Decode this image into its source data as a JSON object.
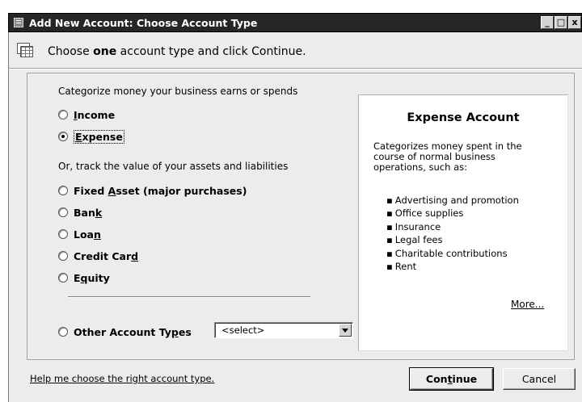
{
  "window": {
    "title": "Add New Account: Choose Account Type",
    "controls": {
      "minimize": "_",
      "maximize": "□",
      "close": "x"
    }
  },
  "header": {
    "text_before": "Choose ",
    "text_bold": "one",
    "text_after": " account type and click Continue."
  },
  "sections": {
    "earn_spend_label": "Categorize money your business earns or spends",
    "assets_label": "Or, track the value of your assets and liabilities"
  },
  "account_types": {
    "income": {
      "pre": "",
      "key": "I",
      "post": "ncome",
      "selected": false
    },
    "expense": {
      "pre": "",
      "key": "E",
      "post": "xpense",
      "selected": true
    },
    "fixed_asset": {
      "pre": "Fixed ",
      "key": "A",
      "post": "sset (major purchases)",
      "selected": false
    },
    "bank": {
      "pre": "Ban",
      "key": "k",
      "post": "",
      "selected": false
    },
    "loan": {
      "pre": "Loa",
      "key": "n",
      "post": "",
      "selected": false
    },
    "credit_card": {
      "pre": "Credit Car",
      "key": "d",
      "post": "",
      "selected": false
    },
    "equity": {
      "pre": "E",
      "key": "q",
      "post": "uity",
      "selected": false
    },
    "other": {
      "pre": "Other Account Ty",
      "key": "p",
      "post": "es",
      "selected": false
    }
  },
  "other_select": {
    "value": "<select>"
  },
  "info_panel": {
    "title": "Expense Account",
    "description": "Categorizes money spent in the course of normal business operations, such as:",
    "items": [
      "Advertising and promotion",
      "Office supplies",
      "Insurance",
      "Legal fees",
      "Charitable contributions",
      "Rent"
    ],
    "more_link": "More..."
  },
  "footer": {
    "help_link": "Help me choose the right account type.",
    "continue": {
      "pre": "Con",
      "key": "t",
      "post": "inue"
    },
    "cancel": "Cancel"
  },
  "colors": {
    "titlebar": "#262626",
    "dialog_bg": "#ececec",
    "info_bg": "#ffffff"
  }
}
